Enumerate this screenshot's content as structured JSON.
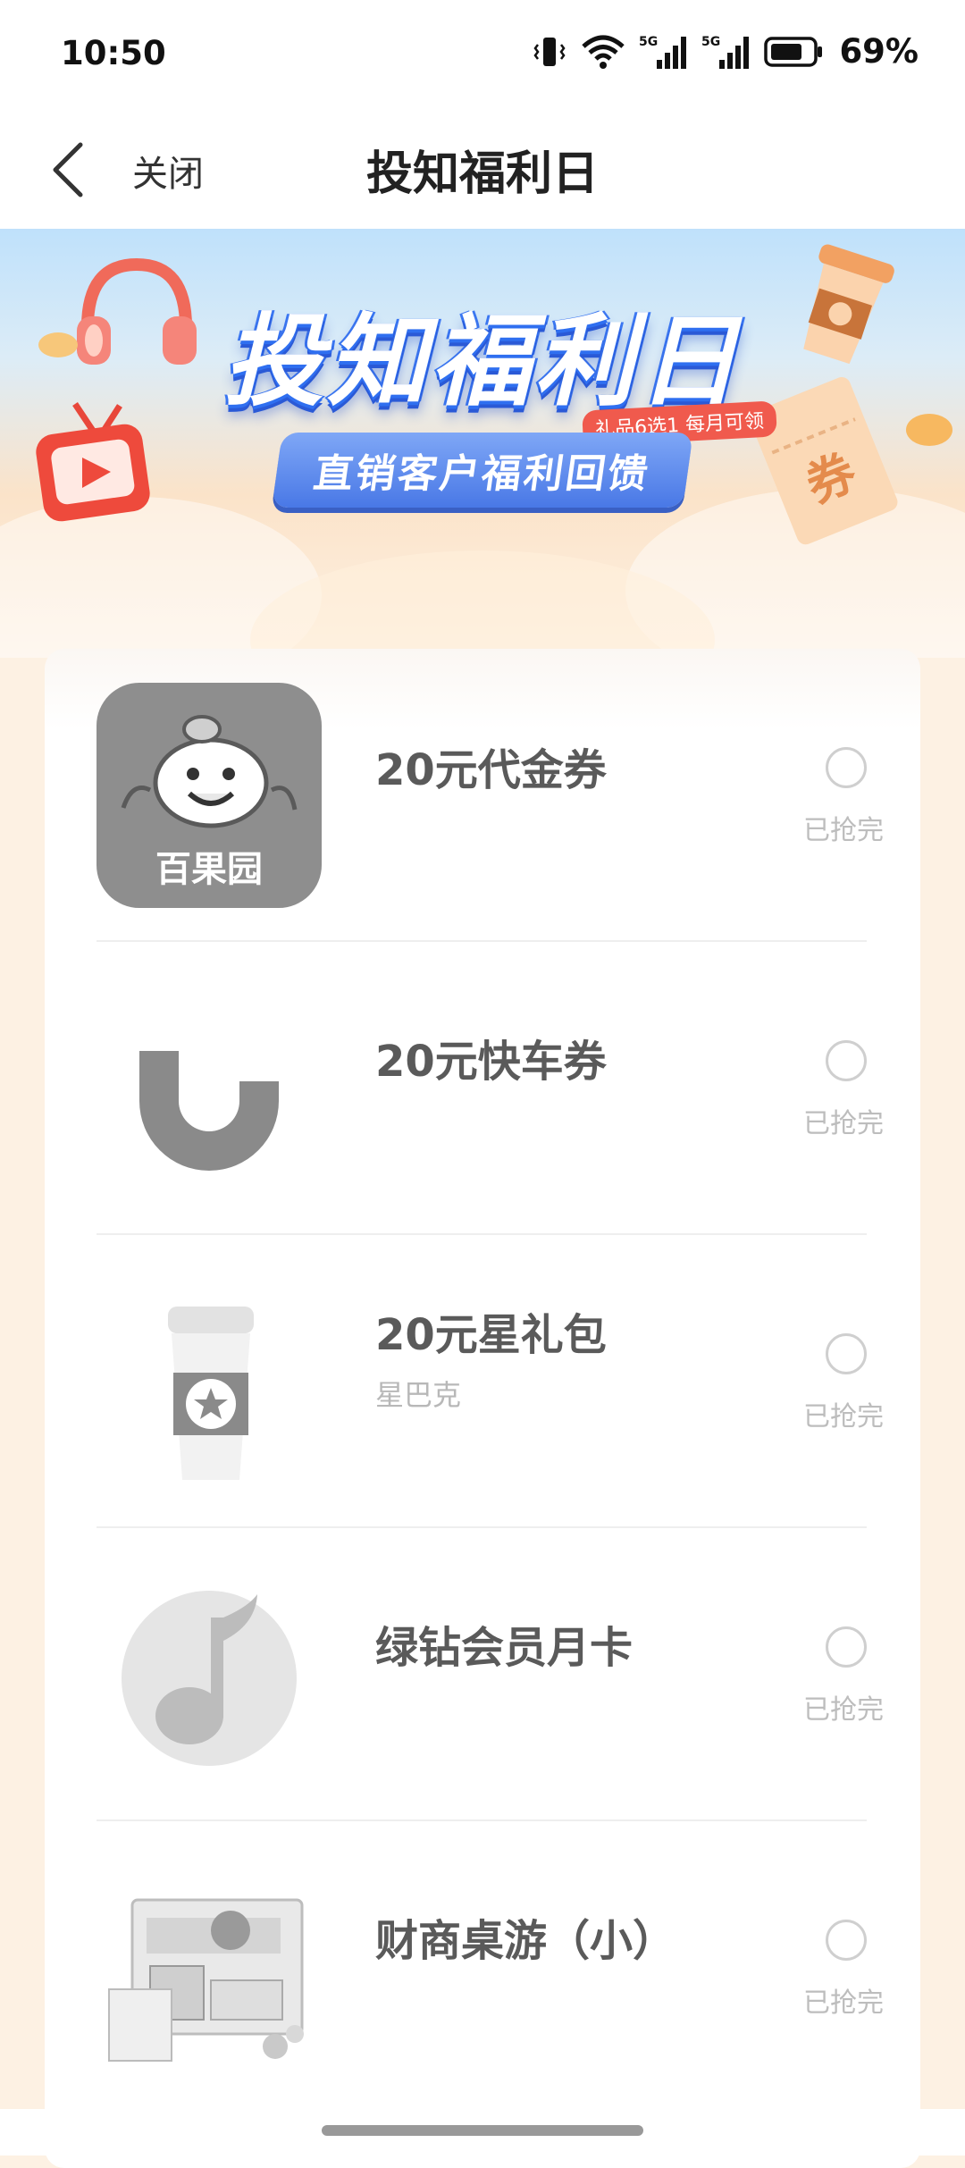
{
  "status_bar": {
    "time": "10:50",
    "battery": "69%",
    "signal1": "5G",
    "signal2": "5G"
  },
  "nav": {
    "close_label": "关闭",
    "title": "投知福利日"
  },
  "banner": {
    "title": "投知福利日",
    "tag": "礼品6选1 每月可领",
    "subtitle": "直销客户福利回馈",
    "ticket_text": "券"
  },
  "gifts": [
    {
      "name": "20元代金券",
      "sub": "",
      "status": "已抢完",
      "brand_text": "百果园",
      "icon": "baiguoyuan-logo-icon"
    },
    {
      "name": "20元快车券",
      "sub": "",
      "status": "已抢完",
      "icon": "didi-logo-icon"
    },
    {
      "name": "20元星礼包",
      "sub": "星巴克",
      "status": "已抢完",
      "icon": "starbucks-cup-icon"
    },
    {
      "name": "绿钻会员月卡",
      "sub": "",
      "status": "已抢完",
      "icon": "qq-music-logo-icon"
    },
    {
      "name": "财商桌游（小）",
      "sub": "",
      "status": "已抢完",
      "icon": "board-game-box-icon"
    }
  ],
  "colors": {
    "page_bg": "#fdf1e3",
    "banner_blue": "#3c78f2",
    "tag_red": "#f05a4d",
    "disabled_gray": "#bdbdbd"
  }
}
